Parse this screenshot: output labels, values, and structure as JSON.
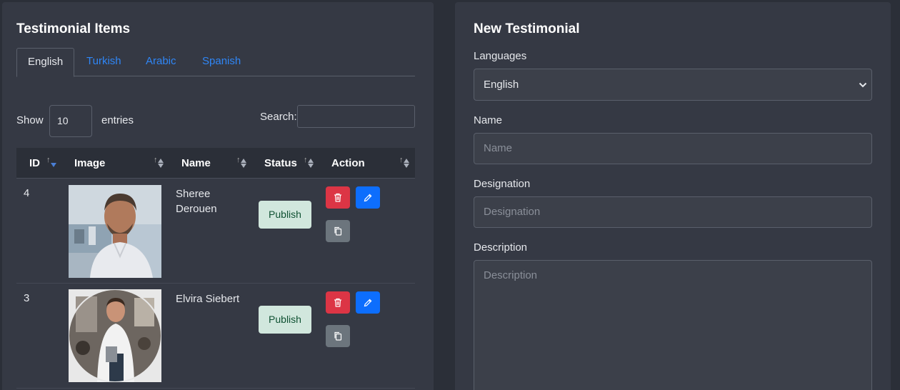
{
  "left": {
    "title": "Testimonial Items",
    "tabs": [
      "English",
      "Turkish",
      "Arabic",
      "Spanish"
    ],
    "show_label": "Show",
    "length_value": "10",
    "entries_label": "entries",
    "search_label": "Search:",
    "columns": [
      "ID",
      "Image",
      "Name",
      "Status",
      "Action"
    ],
    "rows": [
      {
        "id": "4",
        "name": "Sheree Derouen",
        "status": "Publish"
      },
      {
        "id": "3",
        "name": "Elvira Siebert",
        "status": "Publish"
      }
    ]
  },
  "right": {
    "title": "New Testimonial",
    "languages_label": "Languages",
    "languages_value": "English",
    "name_label": "Name",
    "name_placeholder": "Name",
    "designation_label": "Designation",
    "designation_placeholder": "Designation",
    "description_label": "Description",
    "description_placeholder": "Description"
  },
  "colors": {
    "page_bg": "#2b2f38",
    "card_bg": "#353944",
    "link_blue": "#2f86f6",
    "danger": "#dc3545",
    "primary": "#0d6efd",
    "secondary": "#6c757d",
    "success_bg": "#d1e7dd"
  },
  "icons": [
    "trash-icon",
    "pencil-icon",
    "copy-icon",
    "sort-icon",
    "chevron-down-icon"
  ]
}
